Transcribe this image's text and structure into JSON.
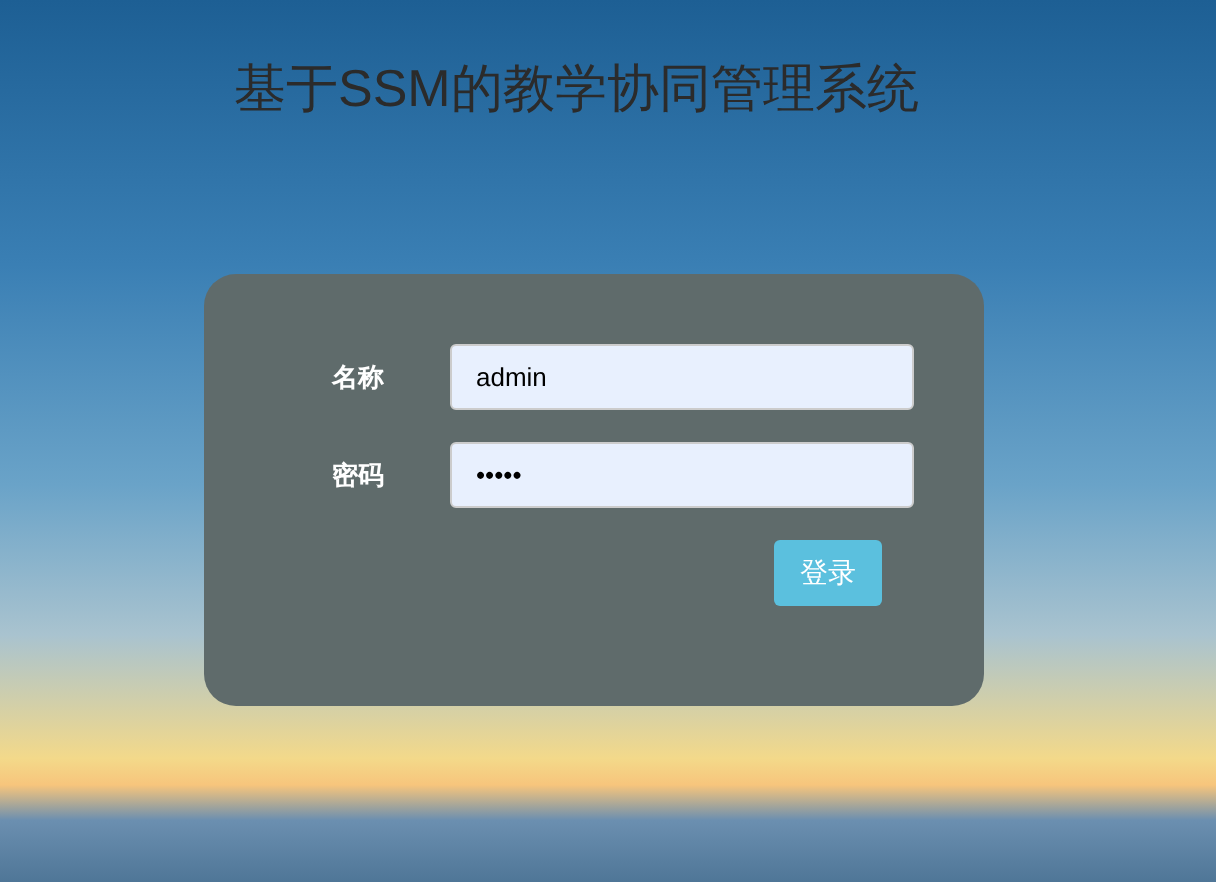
{
  "title": "基于SSM的教学协同管理系统",
  "form": {
    "fields": [
      {
        "label": "名称",
        "value": "admin"
      },
      {
        "label": "密码",
        "value": "•••••"
      }
    ],
    "button": "登录"
  }
}
